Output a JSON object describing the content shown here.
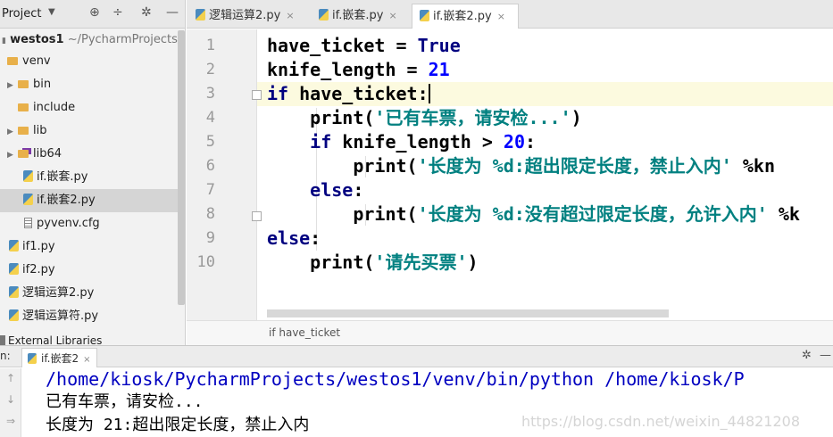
{
  "sidebar": {
    "title": "Project",
    "header_icons": [
      "gear-icon",
      "collapse-icon",
      "settings-icon",
      "minimize-icon"
    ],
    "tree": [
      {
        "label": "westos1",
        "suffix": "~/PycharmProjects/w",
        "type": "project-root"
      },
      {
        "label": "venv",
        "type": "folder"
      },
      {
        "label": "bin",
        "type": "folder"
      },
      {
        "label": "include",
        "type": "folder"
      },
      {
        "label": "lib",
        "type": "folder"
      },
      {
        "label": "lib64",
        "type": "folder"
      },
      {
        "label": "if.嵌套.py",
        "type": "py"
      },
      {
        "label": "if.嵌套2.py",
        "type": "py",
        "selected": true
      },
      {
        "label": "pyvenv.cfg",
        "type": "cfg"
      },
      {
        "label": "if1.py",
        "type": "py"
      },
      {
        "label": "if2.py",
        "type": "py"
      },
      {
        "label": "逻辑运算2.py",
        "type": "py"
      },
      {
        "label": "逻辑运算符.py",
        "type": "py"
      }
    ],
    "external_libraries": "External Libraries"
  },
  "tabs": [
    {
      "label": "逻辑运算2.py",
      "active": false
    },
    {
      "label": "if.嵌套.py",
      "active": false
    },
    {
      "label": "if.嵌套2.py",
      "active": true
    }
  ],
  "editor": {
    "line_numbers": [
      "1",
      "2",
      "3",
      "4",
      "5",
      "6",
      "7",
      "8",
      "9",
      "10"
    ],
    "lines": [
      [
        {
          "t": "have_ticket = ",
          "c": "ctext"
        },
        {
          "t": "True",
          "c": "kw"
        }
      ],
      [
        {
          "t": "knife_length = ",
          "c": "ctext"
        },
        {
          "t": "21",
          "c": "num"
        }
      ],
      [
        {
          "t": "if",
          "c": "kw"
        },
        {
          "t": " have_ticket:",
          "c": "ctext"
        }
      ],
      [
        {
          "t": "    print(",
          "c": "ctext"
        },
        {
          "t": "'已有车票，请安检...'",
          "c": "str"
        },
        {
          "t": ")",
          "c": "ctext"
        }
      ],
      [
        {
          "t": "    ",
          "c": "ctext"
        },
        {
          "t": "if",
          "c": "kw"
        },
        {
          "t": " knife_length > ",
          "c": "ctext"
        },
        {
          "t": "20",
          "c": "num"
        },
        {
          "t": ":",
          "c": "ctext"
        }
      ],
      [
        {
          "t": "        print(",
          "c": "ctext"
        },
        {
          "t": "'长度为 %d:超出限定长度，禁止入内'",
          "c": "str"
        },
        {
          "t": " %kn",
          "c": "ctext"
        }
      ],
      [
        {
          "t": "    ",
          "c": "ctext"
        },
        {
          "t": "else",
          "c": "kw"
        },
        {
          "t": ":",
          "c": "ctext"
        }
      ],
      [
        {
          "t": "        print(",
          "c": "ctext"
        },
        {
          "t": "'长度为 %d:没有超过限定长度，允许入内'",
          "c": "str"
        },
        {
          "t": " %k",
          "c": "ctext"
        }
      ],
      [
        {
          "t": "else",
          "c": "kw"
        },
        {
          "t": ":",
          "c": "ctext"
        }
      ],
      [
        {
          "t": "    print(",
          "c": "ctext"
        },
        {
          "t": "'请先买票'",
          "c": "str"
        },
        {
          "t": ")",
          "c": "ctext"
        }
      ]
    ],
    "caret_line": 3,
    "breadcrumb": "if have_ticket"
  },
  "run_panel": {
    "label": "n:",
    "tab_label": "if.嵌套2",
    "output": {
      "command": "/home/kiosk/PycharmProjects/westos1/venv/bin/python /home/kiosk/P",
      "line1": "已有车票，请安检...",
      "line2": "长度为 21:超出限定长度，禁止入内"
    },
    "tool_icons": [
      "arrow-up-icon",
      "arrow-down-icon",
      "wrap-icon"
    ]
  },
  "watermark": "https://blog.csdn.net/weixin_44821208",
  "colors": {
    "keyword": "#000080",
    "number": "#0000ff",
    "string": "#008080",
    "caret_line": "#fcfadf",
    "folder": "#e8b04a"
  }
}
